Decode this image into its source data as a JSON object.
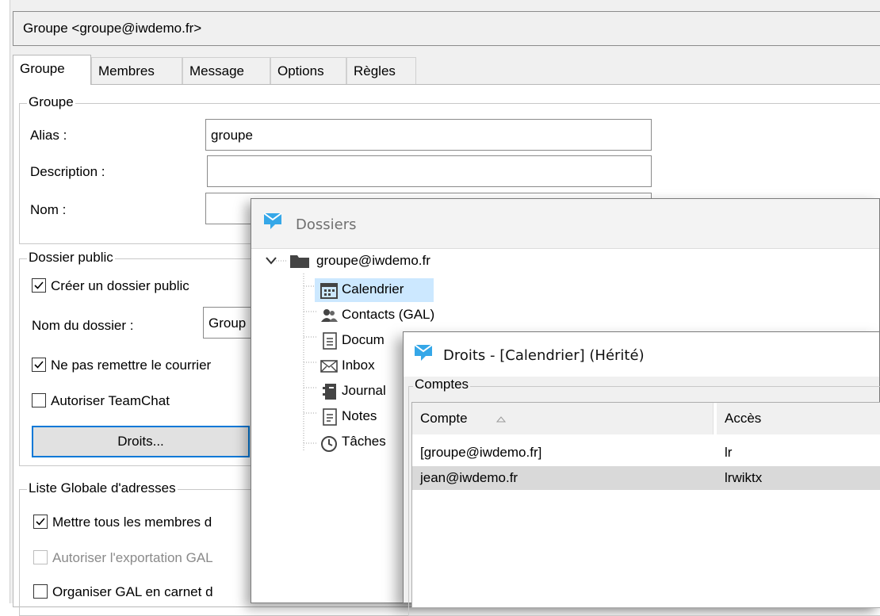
{
  "window_title": "Groupe <groupe@iwdemo.fr>",
  "tabs": [
    {
      "label": "Groupe",
      "active": true
    },
    {
      "label": "Membres"
    },
    {
      "label": "Message"
    },
    {
      "label": "Options"
    },
    {
      "label": "Règles"
    }
  ],
  "group_section": {
    "legend": "Groupe",
    "alias_label": "Alias :",
    "alias_value": "groupe",
    "description_label": "Description :",
    "description_value": "",
    "name_label": "Nom :",
    "name_value": ""
  },
  "public_folder": {
    "legend": "Dossier public",
    "create_label": "Créer un dossier public",
    "create_checked": true,
    "folder_name_label": "Nom du dossier :",
    "folder_name_value": "Group",
    "no_deliver_label": "Ne pas remettre le courrier",
    "no_deliver_checked": true,
    "teamchat_label": "Autoriser TeamChat",
    "teamchat_checked": false,
    "rights_button": "Droits..."
  },
  "gal": {
    "legend": "Liste Globale d'adresses",
    "all_members_label": "Mettre tous les membres d",
    "all_members_checked": true,
    "export_label": "Autoriser l'exportation GAL",
    "export_checked": false,
    "export_disabled": true,
    "organize_label": "Organiser GAL en carnet d",
    "organize_checked": false
  },
  "dossiers": {
    "title": "Dossiers",
    "root": "groupe@iwdemo.fr",
    "items": [
      {
        "label": "Calendrier",
        "icon": "calendar-icon",
        "selected": true
      },
      {
        "label": "Contacts (GAL)",
        "icon": "contacts-icon"
      },
      {
        "label": "Docum",
        "icon": "document-icon"
      },
      {
        "label": "Inbox",
        "icon": "mail-icon"
      },
      {
        "label": "Journal",
        "icon": "journal-icon"
      },
      {
        "label": "Notes",
        "icon": "notes-icon"
      },
      {
        "label": "Tâches",
        "icon": "clock-icon"
      }
    ]
  },
  "droits": {
    "title": "Droits - [Calendrier] (Hérité)",
    "section": "Comptes",
    "col_account": "Compte",
    "col_access": "Accès",
    "rows": [
      {
        "account": "[groupe@iwdemo.fr]",
        "access": "lr",
        "highlighted": false
      },
      {
        "account": "jean@iwdemo.fr",
        "access": "lrwiktx",
        "highlighted": true
      }
    ]
  },
  "colors": {
    "accent": "#0078d7",
    "app_icon": "#35a7e8",
    "selection": "#cce8ff",
    "row_highlight": "#d9d9d9"
  }
}
